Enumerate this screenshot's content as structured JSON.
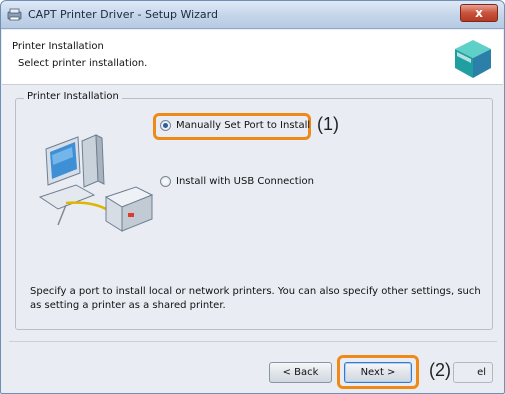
{
  "window": {
    "title": "CAPT Printer Driver - Setup Wizard",
    "close_label": "x"
  },
  "header": {
    "title": "Printer Installation",
    "subtitle": "Select printer installation."
  },
  "group": {
    "label": "Printer Installation",
    "options": [
      {
        "label": "Manually Set Port to Install",
        "selected": true
      },
      {
        "label": "Install with USB Connection",
        "selected": false
      }
    ],
    "description": "Specify a port to install local or network printers. You can also specify other settings, such as setting a printer as a shared printer."
  },
  "annotations": {
    "callout_1": "(1)",
    "callout_2": "(2)",
    "highlight_color": "#ef8a18"
  },
  "buttons": {
    "back": "< Back",
    "next": "Next >",
    "cancel_visible": "el"
  }
}
